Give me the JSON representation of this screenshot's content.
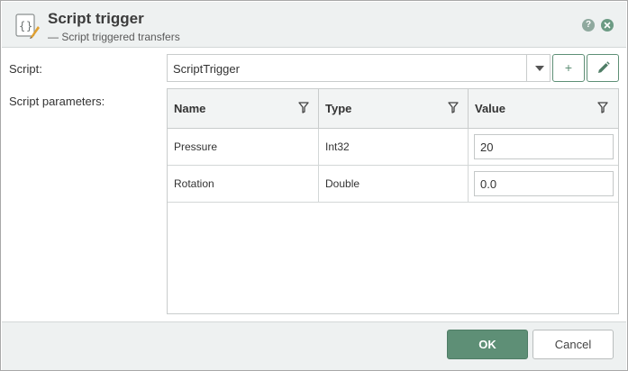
{
  "header": {
    "title": "Script trigger",
    "subtitle": "— Script triggered transfers",
    "icon": "script-braces-icon",
    "help_label": "?",
    "close_icon": "close-icon"
  },
  "form": {
    "script_label": "Script:",
    "script_value": "ScriptTrigger",
    "add_label": "+",
    "edit_icon": "pencil-icon",
    "params_label": "Script parameters:"
  },
  "grid": {
    "columns": [
      "Name",
      "Type",
      "Value"
    ],
    "rows": [
      {
        "name": "Pressure",
        "type": "Int32",
        "value": "20"
      },
      {
        "name": "Rotation",
        "type": "Double",
        "value": "0.0"
      }
    ]
  },
  "footer": {
    "ok_label": "OK",
    "cancel_label": "Cancel"
  },
  "colors": {
    "accent": "#5e8f76",
    "header_bg": "#eef1f1",
    "border": "#c9cccc"
  }
}
